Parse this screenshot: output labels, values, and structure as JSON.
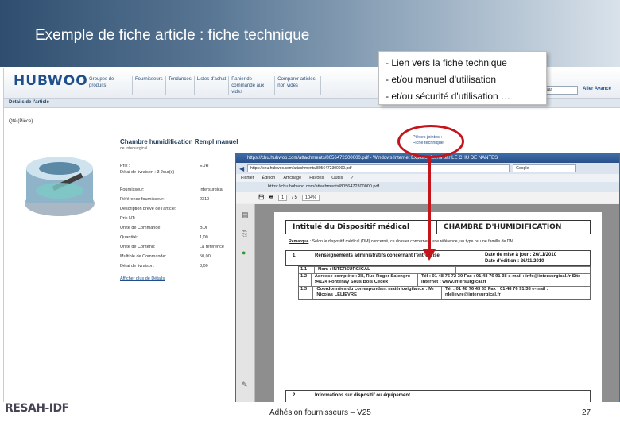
{
  "slide": {
    "title": "Exemple de fiche article : fiche technique"
  },
  "callout": {
    "lines": [
      "- Lien vers la fiche technique",
      "- et/ou manuel d'utilisation",
      "- et/ou sécurité d'utilisation …"
    ]
  },
  "app": {
    "logo": "HUBWOO",
    "nav": [
      "Groupes de produits",
      "Fournisseurs",
      "Tendances",
      "Listes d'achat",
      "Panier de commande aux vides",
      "Comparer articles non vides"
    ],
    "search_value": "Par défaut",
    "search_go": "Aller  Avancé",
    "detail_label": "Détails de l'article",
    "quantity_label": "Qté (Pièce)",
    "product_title": "Chambre humidification Rempl manuel",
    "product_sub": "de Intersurgical",
    "price_label": "Prix :",
    "price_value": "EUR",
    "delay": "Délai de livraison : 3 Jour(s)",
    "details": [
      {
        "k": "Fournisseur:",
        "v": "Intersurgical"
      },
      {
        "k": "Référence fournisseur:",
        "v": "2310"
      },
      {
        "k": "Description brève de l'article:",
        "v": ""
      },
      {
        "k": "Prix NT:",
        "v": ""
      },
      {
        "k": "Unité de Commande:",
        "v": "BOI"
      },
      {
        "k": "Quantité:",
        "v": "1,00"
      },
      {
        "k": "Unité de Contenu:",
        "v": "La référence"
      },
      {
        "k": "Multiple de Commande:",
        "v": "50,00"
      },
      {
        "k": "Délai de livraison:",
        "v": "3,00"
      }
    ],
    "show_details": "Afficher plus de Détails",
    "pieces_label": "Pièces jointes :",
    "pieces_link": "Fiche technique"
  },
  "browser": {
    "title": "https://chu.hubwoo.com/attachments/8056472300000.pdf - Windows Internet Explorer fourni par LE CHU DE NANTES",
    "address": "https://chu.hubwoo.com/attachments/8056472300000.pdf",
    "menu": [
      "Fichier",
      "Édition",
      "Affichage",
      "Favoris",
      "Outils",
      "?"
    ],
    "tab": "https://chu.hubwoo.com/attachments/8056472300000.pdf",
    "page_of": "/ 5",
    "zoom": "104%",
    "search_placeholder": "Google"
  },
  "pdf": {
    "head_left": "Intitulé du Dispositif médical",
    "head_right": "CHAMBRE D'HUMIDIFICATION",
    "remark_label": "Remarque",
    "remark": " : Selon le dispositif médical (DM) concerné, ce dossier concernera une référence, un type ou une famille de DM",
    "section1_num": "1.",
    "section1_text": "Renseignements administratifs concernant l'entreprise",
    "section1_date1": "Date de mise à jour : 26/11/2010",
    "section1_date2": "Date d'édition : 26/11/2010",
    "rows": [
      {
        "n": "1.1",
        "l": "Nom : INTERSURGICAL",
        "r": ""
      },
      {
        "n": "1.2",
        "l": "Adresse complète : 38, Rue Roger Salengro 94124 Fontenay Sous Bois Cedex",
        "r": "Tél : 01 48 76 72 30    Fax : 01 48 76 91 38  e-mail : info@intersurgical.fr  Site internet : www.intersurgical.fr"
      },
      {
        "n": "1.3",
        "l": "Coordonnées du correspondant matériovigilance : Mr Nicolas LELIEVRE",
        "r": "Tél : 01 48 76 43 63  Fax : 01 48 76 91 38  e-mail : nlelievre@intersurgical.fr"
      }
    ],
    "section2_num": "2.",
    "section2_text": "Informations sur dispositif ou équipement"
  },
  "footer": {
    "logo": "RESAH-IDF",
    "center": "Adhésion fournisseurs – V25",
    "page": "27"
  },
  "colors": {
    "accent_red": "#c4141c",
    "header_blue": "#2f4d6e"
  }
}
